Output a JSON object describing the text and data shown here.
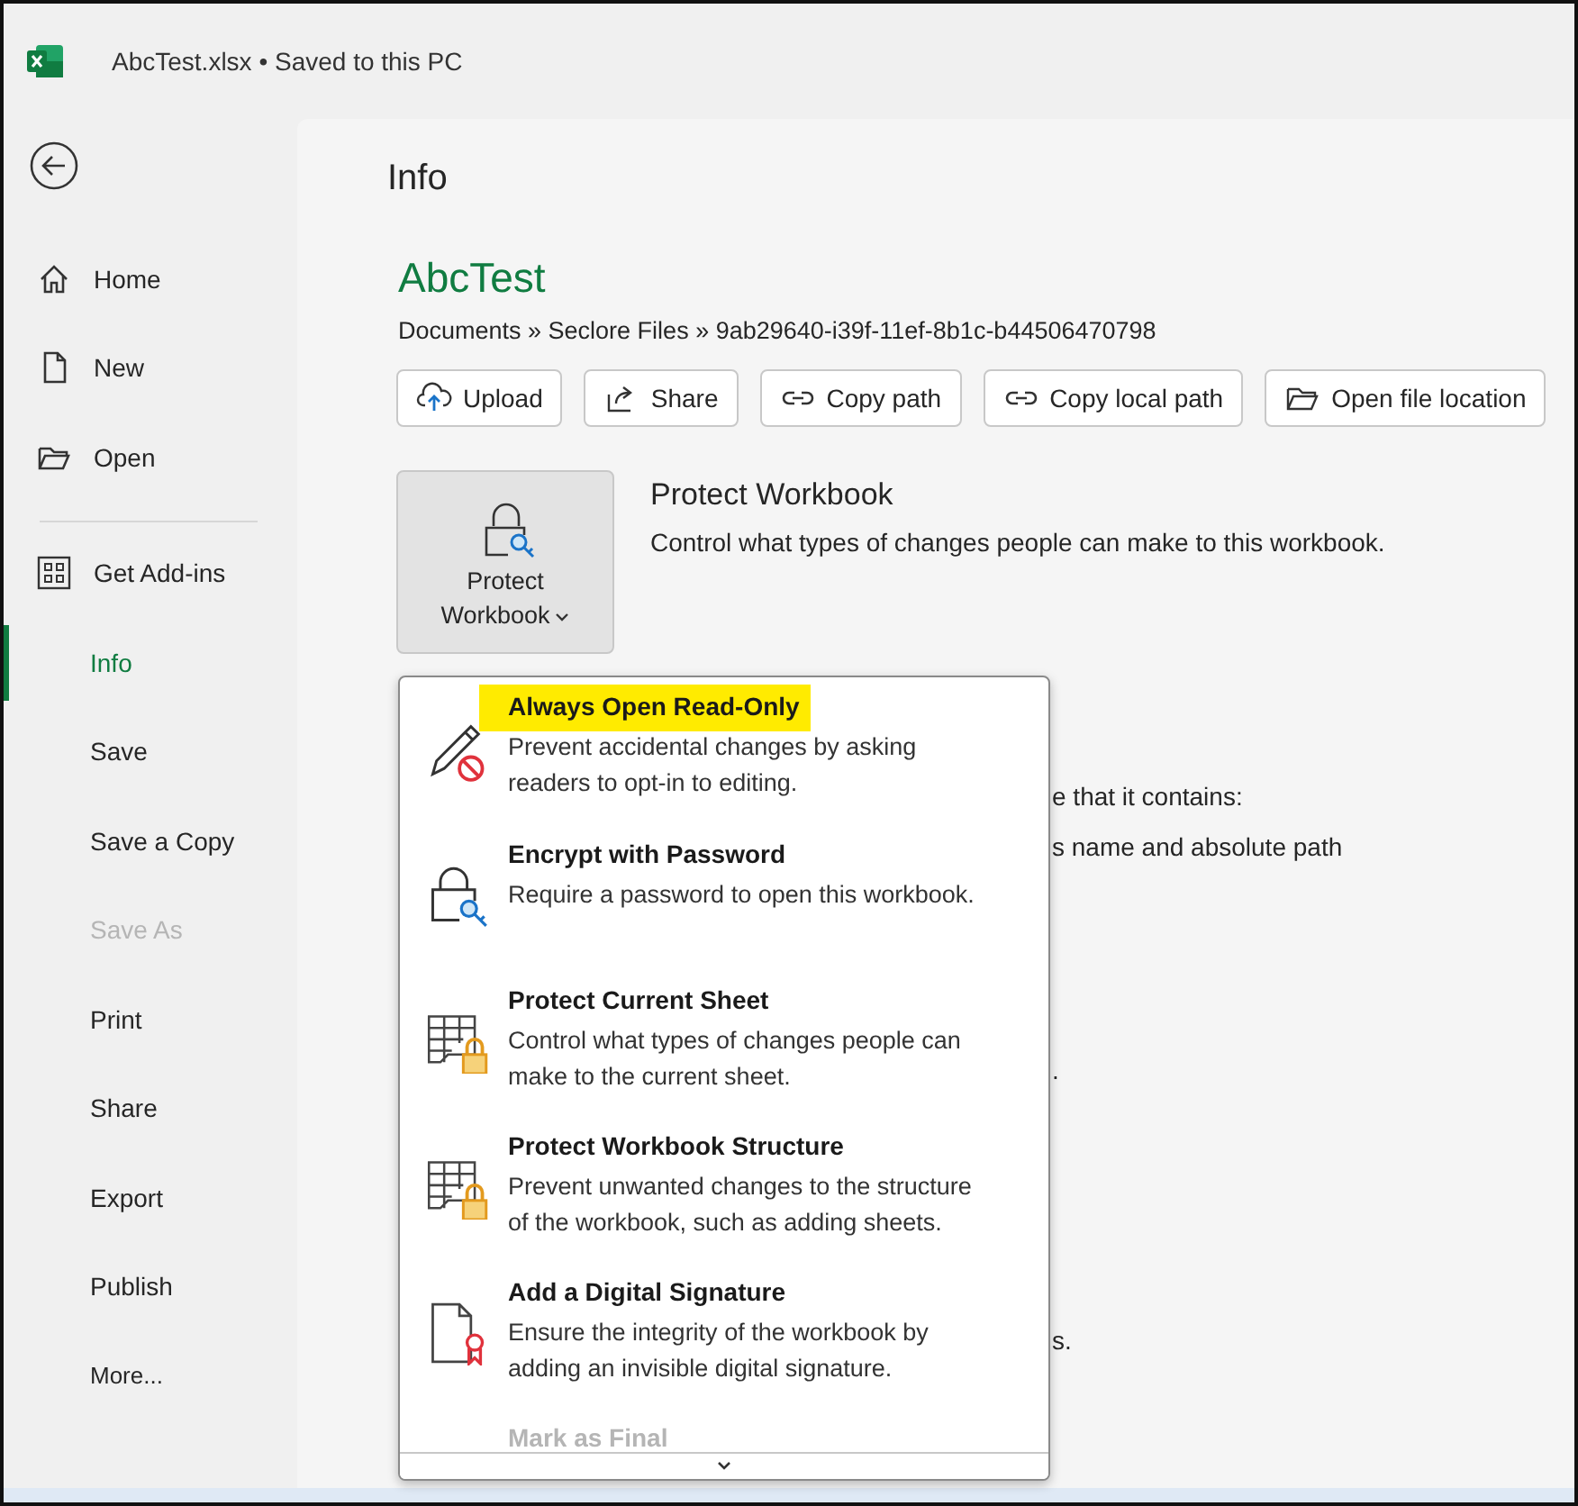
{
  "window": {
    "title": "AbcTest.xlsx • Saved to this PC"
  },
  "sidebar": {
    "top_items": [
      {
        "label": "Home"
      },
      {
        "label": "New"
      },
      {
        "label": "Open"
      },
      {
        "label": "Get Add-ins"
      }
    ],
    "items": [
      {
        "label": "Info",
        "selected": true,
        "disabled": false
      },
      {
        "label": "Save",
        "selected": false,
        "disabled": false
      },
      {
        "label": "Save a Copy",
        "selected": false,
        "disabled": false
      },
      {
        "label": "Save As",
        "selected": false,
        "disabled": true
      },
      {
        "label": "Print",
        "selected": false,
        "disabled": false
      },
      {
        "label": "Share",
        "selected": false,
        "disabled": false
      },
      {
        "label": "Export",
        "selected": false,
        "disabled": false
      },
      {
        "label": "Publish",
        "selected": false,
        "disabled": false
      },
      {
        "label": "More...",
        "selected": false,
        "disabled": false
      }
    ]
  },
  "page_title": "Info",
  "file": {
    "name": "AbcTest",
    "path": "Documents » Seclore Files » 9ab29640-i39f-11ef-8b1c-b44506470798"
  },
  "actions": [
    "Upload",
    "Share",
    "Copy path",
    "Copy local path",
    "Open file location"
  ],
  "protect": {
    "button": "Protect\nWorkbook",
    "heading": "Protect Workbook",
    "description": "Control what types of changes people can make to this workbook."
  },
  "behind_menu_text": [
    "e that it contains:",
    "s name and absolute path",
    ".",
    "s."
  ],
  "protect_menu": [
    {
      "title": "Always Open Read-Only",
      "description": "Prevent accidental changes by asking readers to opt-in to editing.",
      "highlighted": true,
      "disabled": false
    },
    {
      "title": "Encrypt with Password",
      "description": "Require a password to open this workbook.",
      "highlighted": false,
      "disabled": false
    },
    {
      "title": "Protect Current Sheet",
      "description": "Control what types of changes people can make to the current sheet.",
      "highlighted": false,
      "disabled": false
    },
    {
      "title": "Protect Workbook Structure",
      "description": "Prevent unwanted changes to the structure of the workbook, such as adding sheets.",
      "highlighted": false,
      "disabled": false
    },
    {
      "title": "Add a Digital Signature",
      "description": "Ensure the integrity of the workbook by adding an invisible digital signature.",
      "highlighted": false,
      "disabled": false
    },
    {
      "title": "Mark as Final",
      "highlighted": false,
      "disabled": true
    }
  ]
}
